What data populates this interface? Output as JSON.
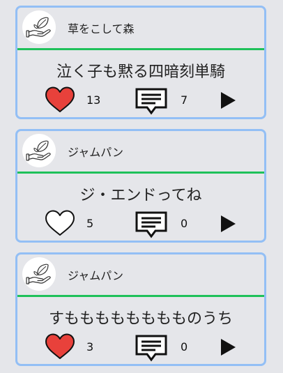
{
  "colors": {
    "card_border": "#93bff5",
    "divider": "#1fc15a",
    "liked_heart": "#e8413b",
    "background": "#e5e6ea"
  },
  "posts": [
    {
      "username": "草をこして森",
      "text": "泣く子も黙る四暗刻単騎",
      "likes": "13",
      "comments": "7",
      "liked": true,
      "avatar_icon": "hand-leaf-icon",
      "like_icon": "heart-filled-icon",
      "comment_icon": "comment-icon",
      "play_icon": "play-icon"
    },
    {
      "username": "ジャムパン",
      "text": "ジ・エンドってね",
      "likes": "5",
      "comments": "0",
      "liked": false,
      "avatar_icon": "hand-leaf-icon",
      "like_icon": "heart-outline-icon",
      "comment_icon": "comment-icon",
      "play_icon": "play-icon"
    },
    {
      "username": "ジャムパン",
      "text": "すもももももももものうち",
      "likes": "3",
      "comments": "0",
      "liked": true,
      "avatar_icon": "hand-leaf-icon",
      "like_icon": "heart-filled-icon",
      "comment_icon": "comment-icon",
      "play_icon": "play-icon"
    }
  ]
}
